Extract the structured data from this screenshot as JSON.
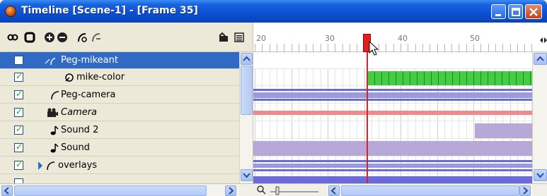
{
  "window": {
    "title": "Timeline [Scene-1] - [Frame 35]"
  },
  "ruler": {
    "labels": [
      "20",
      "30",
      "40",
      "50"
    ],
    "current_frame": 35
  },
  "layers": [
    {
      "name": "Peg-mikeant",
      "checked": false,
      "selected": true,
      "icon": "peg-icon",
      "italic": false
    },
    {
      "name": "mike-color",
      "checked": true,
      "selected": false,
      "icon": "drawing-icon",
      "italic": false
    },
    {
      "name": "Peg-camera",
      "checked": true,
      "selected": false,
      "icon": "peg-icon",
      "italic": false
    },
    {
      "name": "Camera",
      "checked": true,
      "selected": false,
      "icon": "camera-icon",
      "italic": true
    },
    {
      "name": "Sound 2",
      "checked": true,
      "selected": false,
      "icon": "sound-icon",
      "italic": false
    },
    {
      "name": "Sound",
      "checked": true,
      "selected": false,
      "icon": "sound-icon",
      "italic": false
    },
    {
      "name": "overlays",
      "checked": true,
      "selected": false,
      "icon": "peg-icon",
      "italic": false
    }
  ],
  "colors": {
    "title_bar": "#0a4fd2",
    "selected_row": "#316ac5",
    "playhead": "#e02020",
    "drawing_cells": "#44cc44",
    "peg_bar": "#6a6ad8",
    "camera_bar": "#f08a8a",
    "sound_bar": "#b8a8d8"
  }
}
